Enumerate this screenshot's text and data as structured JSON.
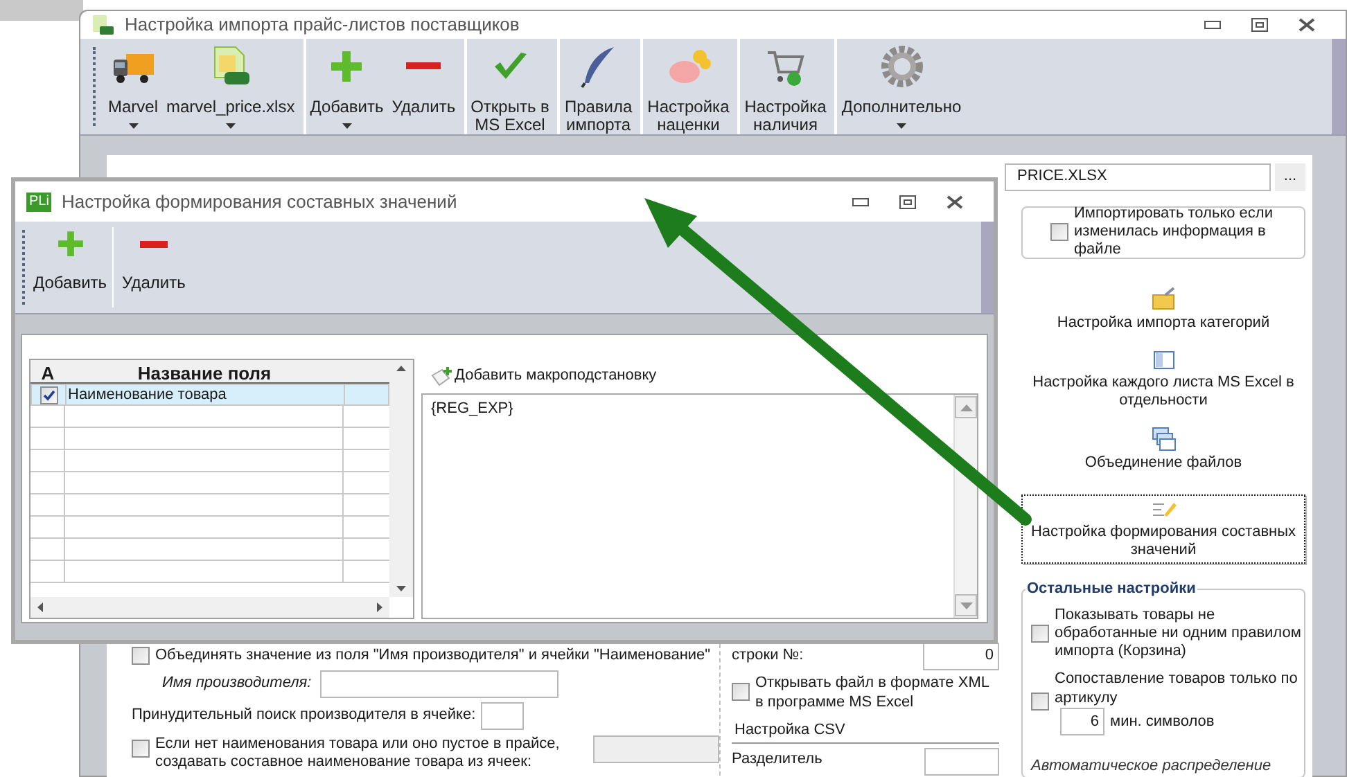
{
  "main_window": {
    "title": "Настройка импорта прайс-листов поставщиков",
    "toolbar": [
      {
        "kind": "truck",
        "label": "Marvel",
        "dropdown": true,
        "group_start": false
      },
      {
        "kind": "xls",
        "label": "marvel_price.xlsx",
        "dropdown": true,
        "group_start": false
      },
      {
        "kind": "plus",
        "label": "Добавить",
        "dropdown": true,
        "group_start": true
      },
      {
        "kind": "minus",
        "label": "Удалить",
        "dropdown": false,
        "group_start": false
      },
      {
        "kind": "check",
        "label": "Открыть в\nMS Excel",
        "dropdown": false,
        "group_start": true
      },
      {
        "kind": "feather",
        "label": "Правила\nимпорта",
        "dropdown": false,
        "group_start": true
      },
      {
        "kind": "piggy",
        "label": "Настройка\nнаценки",
        "dropdown": false,
        "group_start": true
      },
      {
        "kind": "cart",
        "label": "Настройка\nналичия",
        "dropdown": false,
        "group_start": true
      },
      {
        "kind": "gear",
        "label": "Дополнительно",
        "dropdown": true,
        "group_start": true
      }
    ],
    "file_path": "PRICE.XLSX",
    "browse": "...",
    "import_if_changed": {
      "label": "Импортировать только если изменилась информация в файле",
      "checked": false
    },
    "links": [
      {
        "kind": "folder",
        "label": "Настройка импорта категорий",
        "focused": false
      },
      {
        "kind": "sheet",
        "label": "Настройка каждого листа MS Excel в отдельности",
        "focused": false
      },
      {
        "kind": "windows",
        "label": "Объединение файлов",
        "focused": false
      },
      {
        "kind": "pen",
        "label": "Настройка формирования составных значений",
        "focused": true
      }
    ],
    "other_settings": {
      "title": "Остальные настройки",
      "show_basket": {
        "label": "Показывать товары не обработанные ни одним правилом импорта (Корзина)",
        "checked": false
      },
      "match_by_article": {
        "label": "Сопоставление товаров только по артикулу",
        "checked": false,
        "value": "6",
        "suffix": "мин. символов"
      },
      "auto_note": "Автоматическое распределение"
    },
    "options": {
      "merge_manufacturer": {
        "label": "Объединять значение из поля \"Имя производителя\" и ячейки \"Наименование\"",
        "checked": false
      },
      "manufacturer_name": {
        "label": "Имя производителя:"
      },
      "force_search": {
        "label": "Принудительный поиск производителя в ячейке:"
      },
      "composite_name": {
        "label": "Если нет наименования товара или оно пустое в прайсе, создавать составное наименование товара из ячеек:",
        "checked": false
      }
    },
    "row_number": {
      "label": "строки №:",
      "value": "0"
    },
    "open_xml": {
      "label": "Открывать файл в формате XML в программе MS Excel",
      "checked": false
    },
    "csv": {
      "title": "Настройка CSV",
      "separator_label": "Разделитель"
    }
  },
  "dialog": {
    "icon_text": "PLi",
    "title": "Настройка формирования составных значений",
    "toolbar": [
      {
        "kind": "plus",
        "label": "Добавить"
      },
      {
        "kind": "minus",
        "label": "Удалить"
      }
    ],
    "grid": {
      "columns": [
        "A",
        "Название поля"
      ],
      "rows": [
        {
          "checked": true,
          "name": "Наименование товара",
          "selected": true
        }
      ]
    },
    "add_macro": "Добавить макроподстановку",
    "expression": "{REG_EXP}"
  }
}
